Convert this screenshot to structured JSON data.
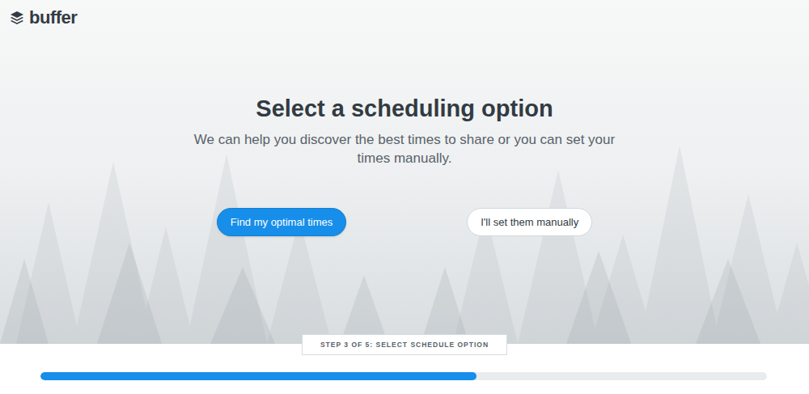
{
  "logo": {
    "text": "buffer"
  },
  "heading": "Select a scheduling option",
  "subtitle": "We can help you discover the best times to share or you can set your times manually.",
  "buttons": [
    {
      "label": "Find my optimal times",
      "kind": "primary"
    },
    {
      "label": "I'll set them manually",
      "kind": "secondary"
    }
  ],
  "progress": {
    "step_label": "STEP 3 OF 5: SELECT SCHEDULE OPTION",
    "level": 0.6
  }
}
